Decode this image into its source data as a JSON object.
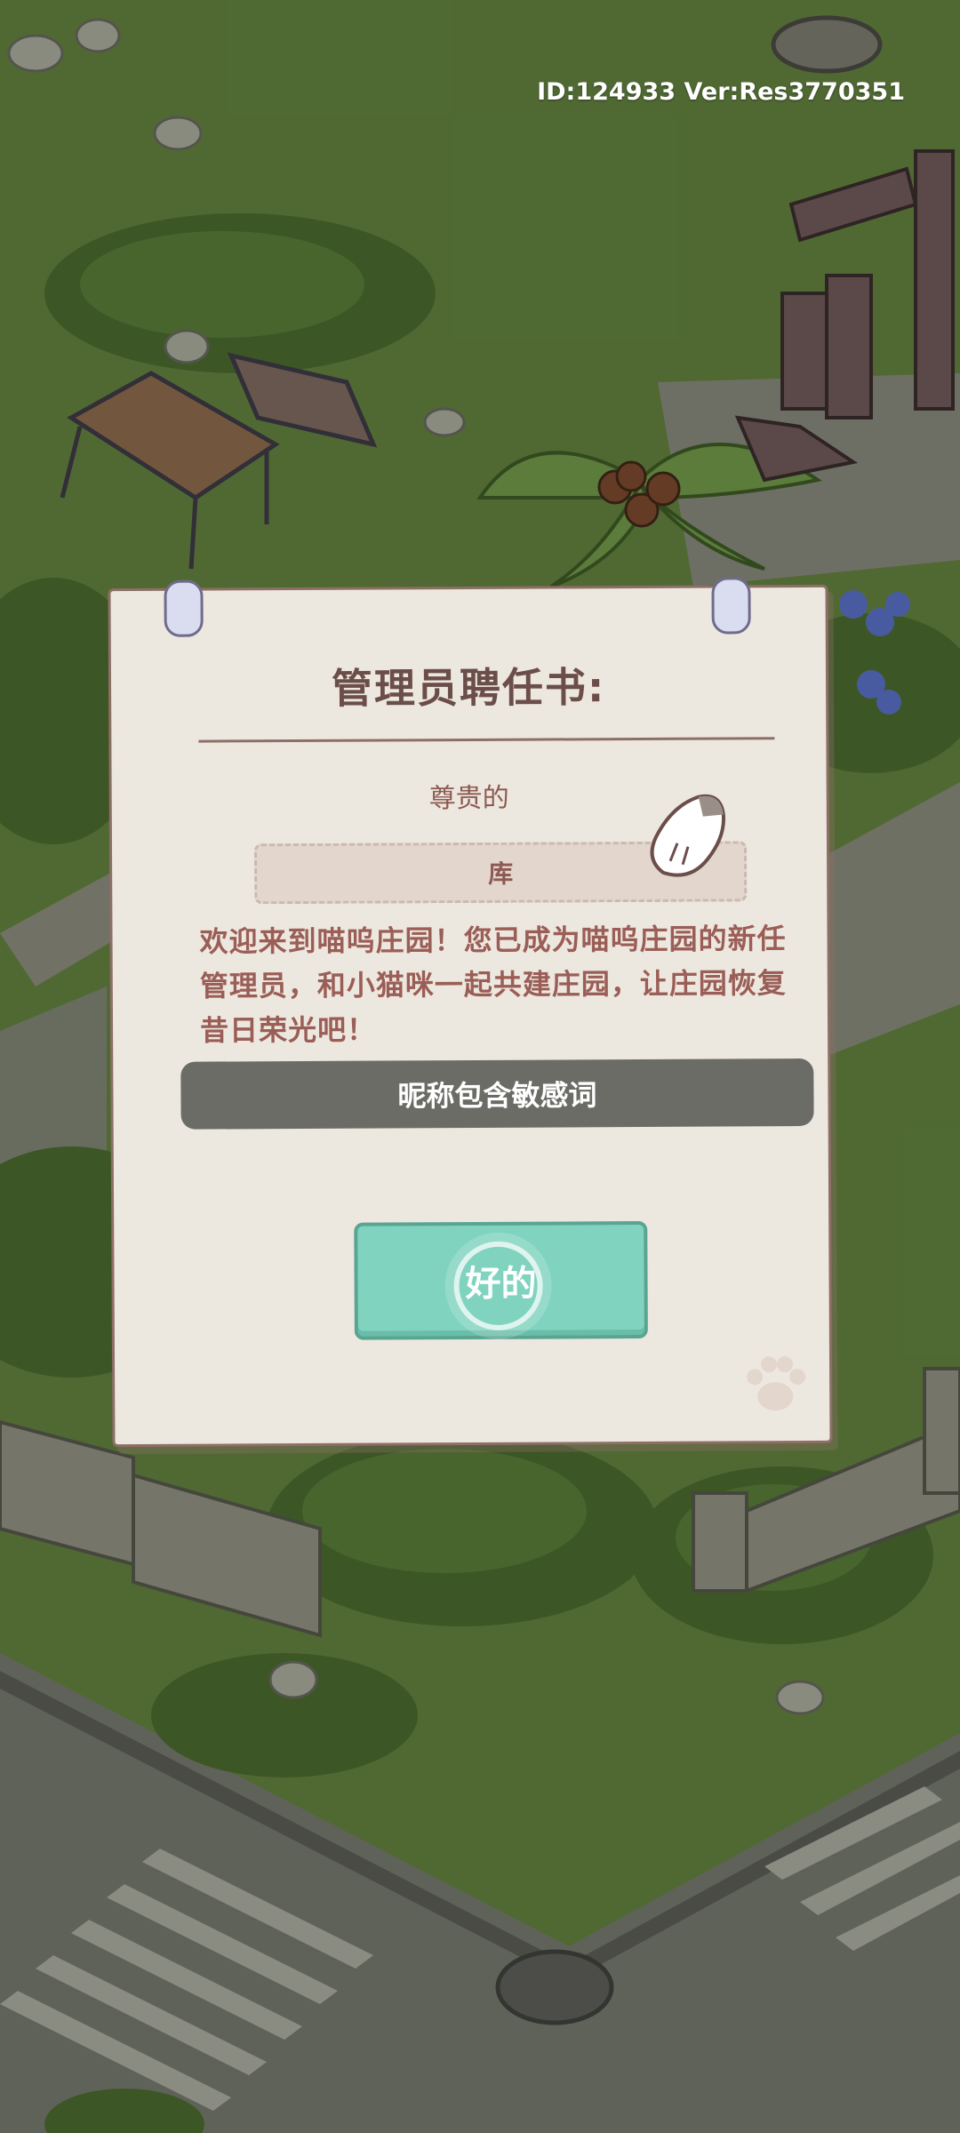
{
  "hud": {
    "version_text": "ID:124933 Ver:Res3770351"
  },
  "letter": {
    "title": "管理员聘任书:",
    "honorific": "尊贵的",
    "player_name": "库",
    "welcome_text": "欢迎来到喵呜庄园！您已成为喵呜庄园的新任管理员，和小猫咪一起共建庄园，让庄园恢复昔日荣光吧！",
    "confirm_label": "好的"
  },
  "toast": {
    "message": "昵称包含敏感词"
  },
  "icons": {
    "pointer": "cat-paw-pointer-icon",
    "stamp": "paw-print-icon",
    "tap": "tap-ring-indicator"
  },
  "colors": {
    "paper": "#ede8df",
    "ink": "#6b4e49",
    "button": "#7fd3bf",
    "toast": "#5a5a55"
  }
}
